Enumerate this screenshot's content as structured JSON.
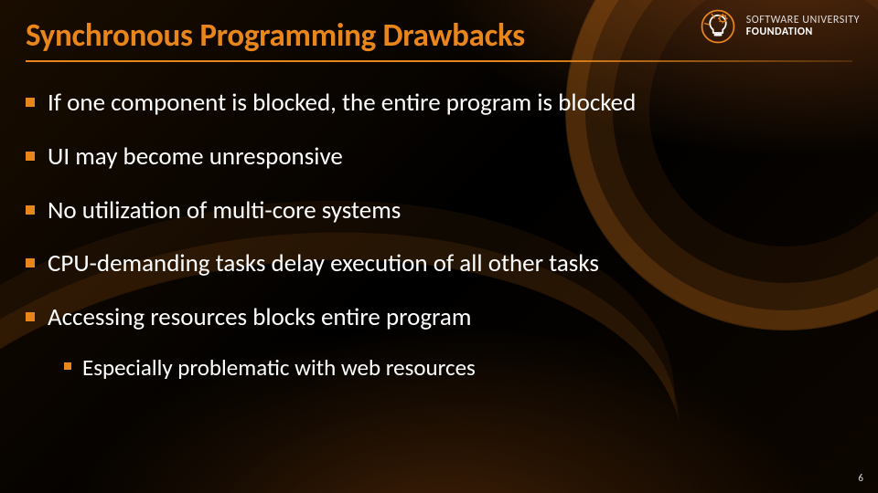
{
  "title": "Synchronous Programming Drawbacks",
  "logo": {
    "line1": "SOFTWARE UNIVERSITY",
    "line2": "FOUNDATION",
    "icon_name": "lightbulb-gear-icon"
  },
  "bullets": [
    {
      "text": "If one component is blocked, the entire program is blocked"
    },
    {
      "text": "UI may become unresponsive"
    },
    {
      "text": "No utilization of multi-core systems"
    },
    {
      "text": "CPU-demanding tasks delay execution of all other tasks"
    },
    {
      "text": "Accessing resources blocks entire program",
      "sub": [
        {
          "text": "Especially problematic with web resources"
        }
      ]
    }
  ],
  "page_number": "6",
  "colors": {
    "accent": "#e8861c",
    "text": "#ffffff",
    "bg": "#000000"
  }
}
